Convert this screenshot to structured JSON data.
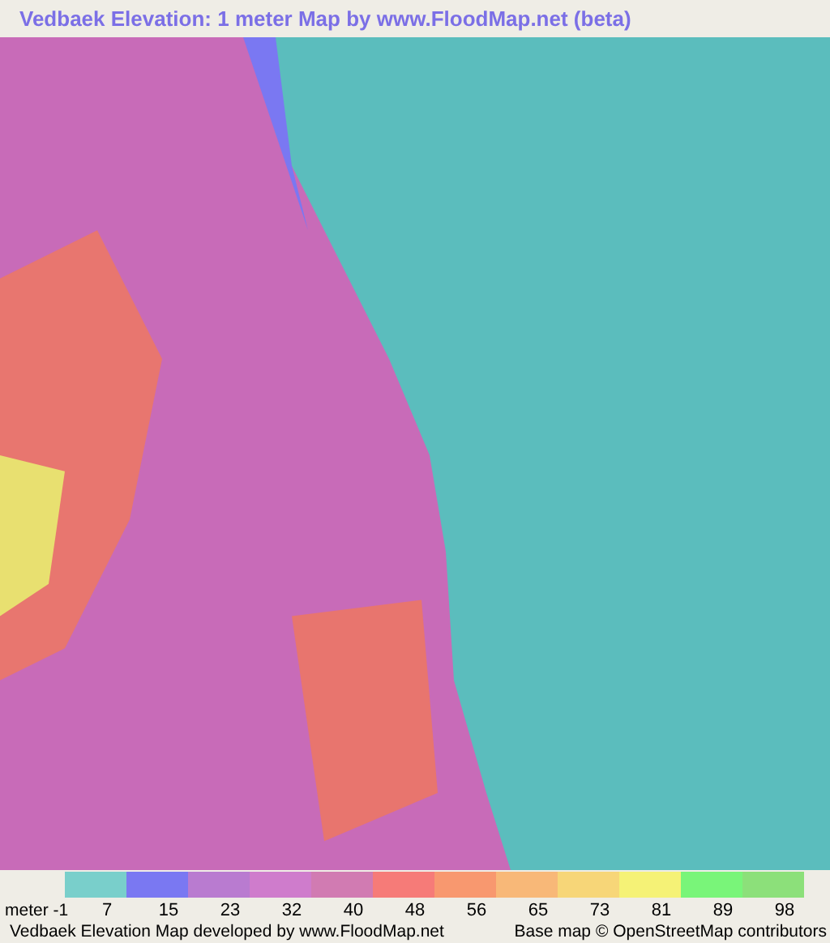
{
  "title": "Vedbaek Elevation: 1 meter Map by www.FloodMap.net (beta)",
  "legend": {
    "unit_label": "meter -1",
    "swatches": [
      {
        "color": "#79cfcb"
      },
      {
        "color": "#7a78f2"
      },
      {
        "color": "#b97bd0"
      },
      {
        "color": "#cf7ccc"
      },
      {
        "color": "#d17bb2"
      },
      {
        "color": "#f67b78"
      },
      {
        "color": "#f8986f"
      },
      {
        "color": "#f8b878"
      },
      {
        "color": "#f7d678"
      },
      {
        "color": "#f5f276"
      },
      {
        "color": "#79f579"
      },
      {
        "color": "#8ce07a"
      }
    ],
    "ticks": [
      "7",
      "15",
      "23",
      "32",
      "40",
      "48",
      "56",
      "65",
      "73",
      "81",
      "89",
      "98"
    ]
  },
  "footer": {
    "credit": "Vedbaek Elevation Map developed by www.FloodMap.net",
    "attribution": "Base map © OpenStreetMap contributors"
  }
}
